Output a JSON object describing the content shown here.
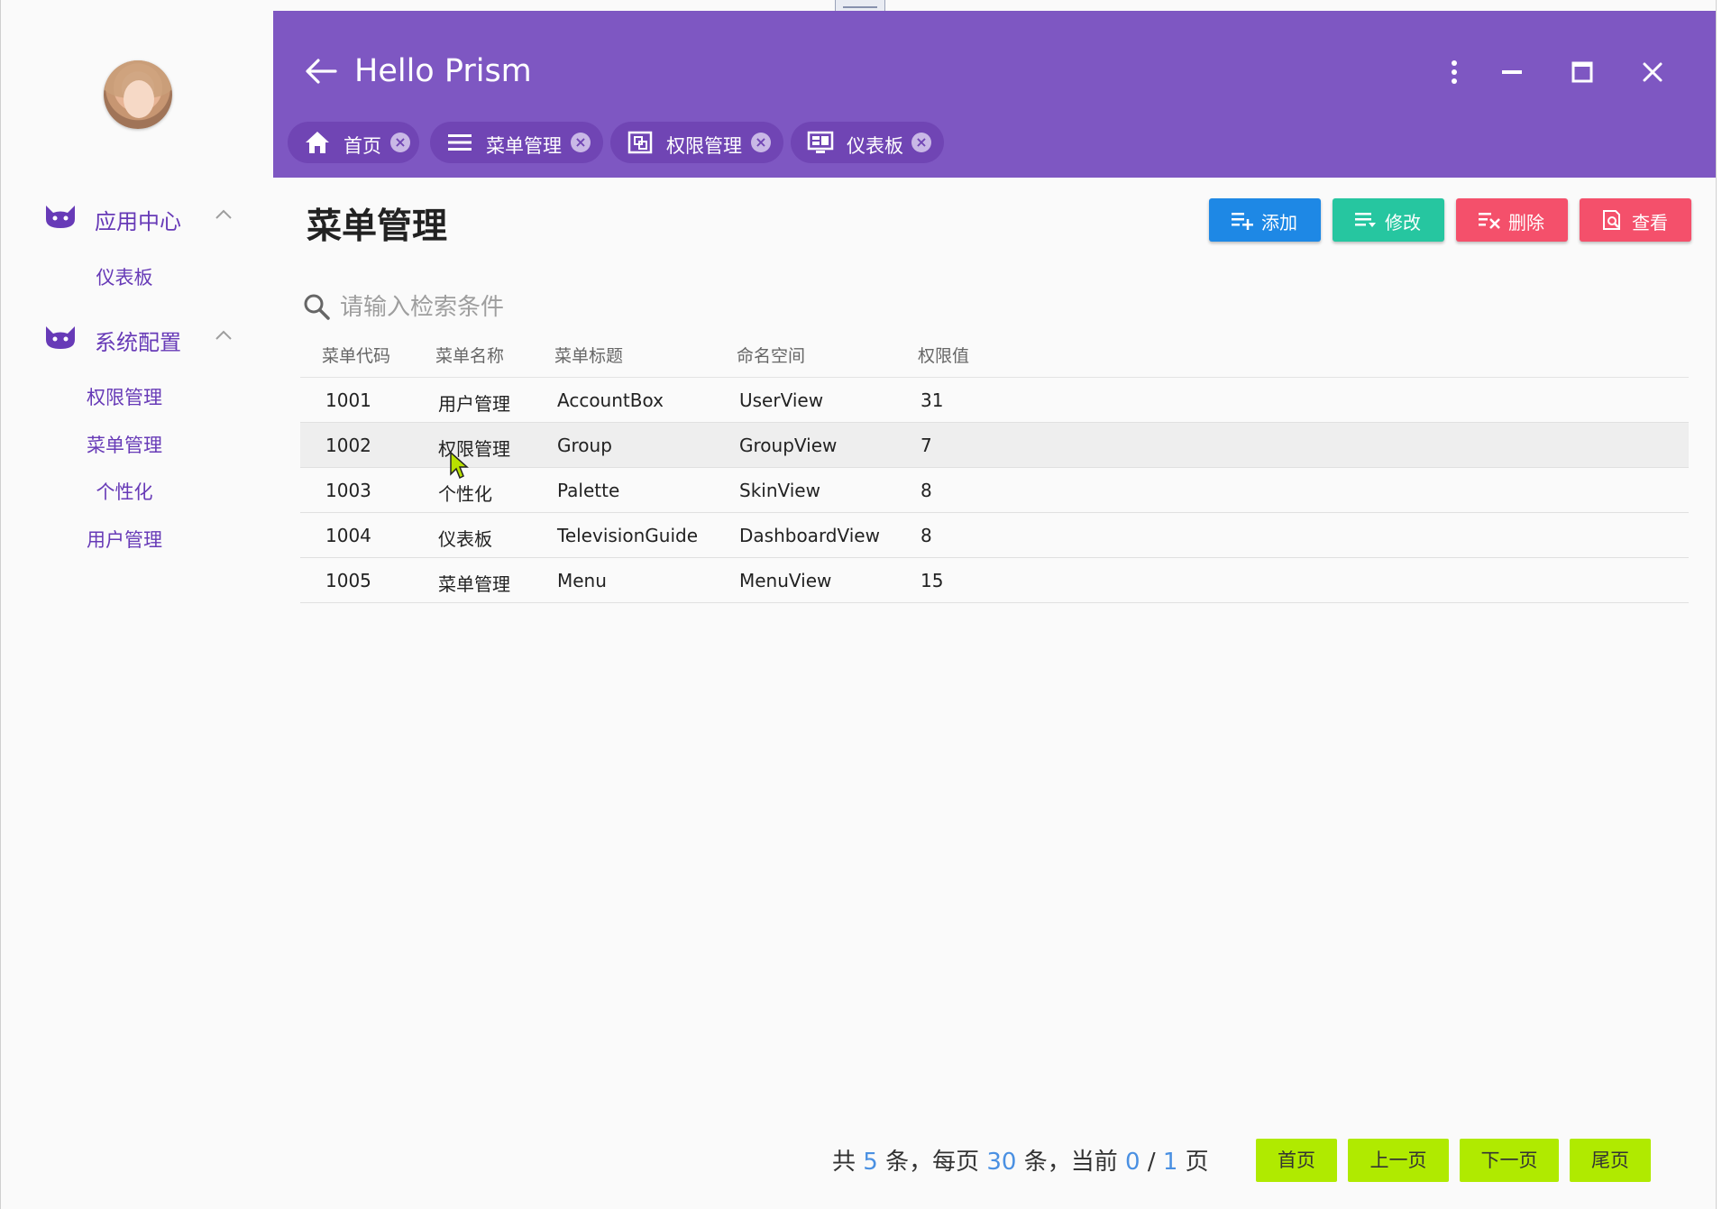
{
  "app": {
    "title": "Hello Prism"
  },
  "sidebar": {
    "groups": [
      {
        "label": "应用中心",
        "items": [
          "仪表板"
        ]
      },
      {
        "label": "系统配置",
        "items": [
          "权限管理",
          "菜单管理",
          "个性化",
          "用户管理"
        ]
      }
    ]
  },
  "tabs": [
    {
      "label": "首页",
      "icon": "home-icon"
    },
    {
      "label": "菜单管理",
      "icon": "menu-icon"
    },
    {
      "label": "权限管理",
      "icon": "permission-icon"
    },
    {
      "label": "仪表板",
      "icon": "dashboard-icon"
    }
  ],
  "main": {
    "title": "菜单管理",
    "actions": [
      {
        "label": "添加",
        "color": "#1e88e5"
      },
      {
        "label": "修改",
        "color": "#26c6a0"
      },
      {
        "label": "删除",
        "color": "#f4506b"
      },
      {
        "label": "查看",
        "color": "#f4506b"
      }
    ],
    "search_placeholder": "请输入检索条件"
  },
  "table": {
    "headers": [
      "菜单代码",
      "菜单名称",
      "菜单标题",
      "命名空间",
      "权限值"
    ],
    "rows": [
      [
        "1001",
        "用户管理",
        "AccountBox",
        "UserView",
        "31"
      ],
      [
        "1002",
        "权限管理",
        "Group",
        "GroupView",
        "7"
      ],
      [
        "1003",
        "个性化",
        "Palette",
        "SkinView",
        "8"
      ],
      [
        "1004",
        "仪表板",
        "TelevisionGuide",
        "DashboardView",
        "8"
      ],
      [
        "1005",
        "菜单管理",
        "Menu",
        "MenuView",
        "15"
      ]
    ]
  },
  "pagination": {
    "t1": "共",
    "total": "5",
    "t2": "条，每页",
    "per_page": "30",
    "t3": "条，当前",
    "current": "0",
    "sep": "/",
    "pages": "1",
    "t4": "页",
    "buttons": [
      "首页",
      "上一页",
      "下一页",
      "尾页"
    ]
  },
  "colors": {
    "header": "#7e57c2",
    "accent": "#673ab7",
    "pager_button": "#b0ea00"
  }
}
